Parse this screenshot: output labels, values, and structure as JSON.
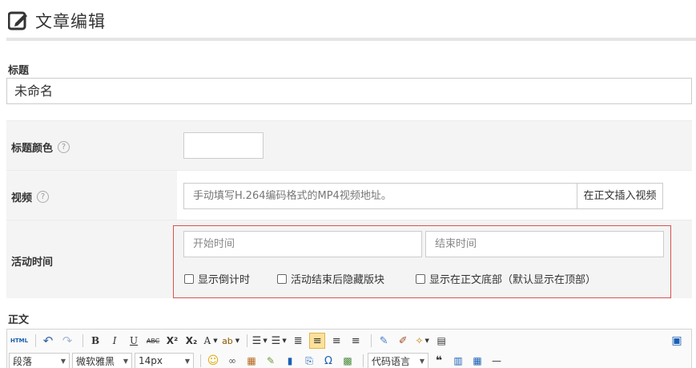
{
  "header": {
    "title": "文章编辑",
    "icon": "edit-icon"
  },
  "title_field": {
    "label": "标题",
    "value": "未命名"
  },
  "rows": {
    "title_color": {
      "label": "标题颜色",
      "help": "?"
    },
    "video": {
      "label": "视频",
      "help": "?",
      "placeholder": "手动填写H.264编码格式的MP4视频地址。",
      "button": "在正文插入视频"
    },
    "activity_time": {
      "label": "活动时间",
      "start_placeholder": "开始时间",
      "end_placeholder": "结束时间",
      "checkboxes": [
        "显示倒计时",
        "活动结束后隐藏版块",
        "显示在正文底部（默认显示在顶部）"
      ]
    }
  },
  "body_field": {
    "label": "正文"
  },
  "toolbar": {
    "row1": [
      "HTML",
      "undo",
      "redo",
      "B",
      "I",
      "U",
      "ABC",
      "X²",
      "X₂",
      "A",
      "ab",
      "ol",
      "ul",
      "indent",
      "align-left",
      "align-center",
      "align-right",
      "eraser",
      "brush",
      "magic",
      "paste"
    ],
    "html_label": "HTML",
    "bold": "B",
    "italic": "I",
    "underline": "U",
    "strike": "ABC",
    "sup": "X²",
    "sub": "X₂",
    "font_color": "A",
    "paragraph": "段落",
    "font_family": "微软雅黑",
    "font_size": "14px",
    "code_lang": "代码语言",
    "quote": "❝",
    "hr": "—"
  }
}
